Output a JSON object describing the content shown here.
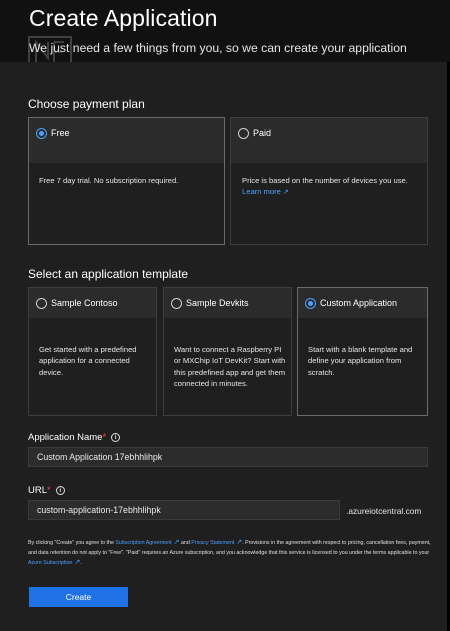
{
  "header": {
    "title": "Create Application",
    "subtitle": "We just need a few things from you, so we can create your application"
  },
  "payment": {
    "section_title": "Choose payment plan",
    "plans": [
      {
        "label": "Free",
        "selected": true,
        "description": "Free 7 day trial. No subscription required."
      },
      {
        "label": "Paid",
        "selected": false,
        "description": "Price is based on the number of devices you use.",
        "link": "Learn more"
      }
    ]
  },
  "template": {
    "section_title": "Select an application template",
    "options": [
      {
        "label": "Sample Contoso",
        "selected": false,
        "description": "Get started with a predefined application for a connected device."
      },
      {
        "label": "Sample Devkits",
        "selected": false,
        "description": "Want to connect a Raspberry PI or MXChip IoT DevKit? Start with this predefined app and get them connected in minutes."
      },
      {
        "label": "Custom Application",
        "selected": true,
        "description": "Start with a blank template and define your application from scratch."
      }
    ]
  },
  "app_name": {
    "label": "Application Name",
    "required_mark": "*",
    "value": "Custom Application 17ebhhlihpk"
  },
  "url": {
    "label": "URL",
    "required_mark": "*",
    "value": "custom-application-17ebhhlihpk",
    "suffix": ".azureiotcentral.com"
  },
  "legal": {
    "part1": "By clicking \"Create\" you agree to the ",
    "link1": "Subscription Agreement",
    "part2": " and ",
    "link2": "Privacy Statement",
    "part3": ". Provisions in the agreement with respect to pricing, cancellation fees, payment, and data retention do not apply to \"Free\". \"Paid\" requires an Azure subscription, and you acknowledge that this service is licensed to you under the terms applicable to your ",
    "link3": "Azure Subscription",
    "part4": "."
  },
  "create_button": {
    "label": "Create"
  },
  "colors": {
    "accent": "#1f72e6",
    "link": "#4aa0ff",
    "required": "#e84c4c"
  }
}
